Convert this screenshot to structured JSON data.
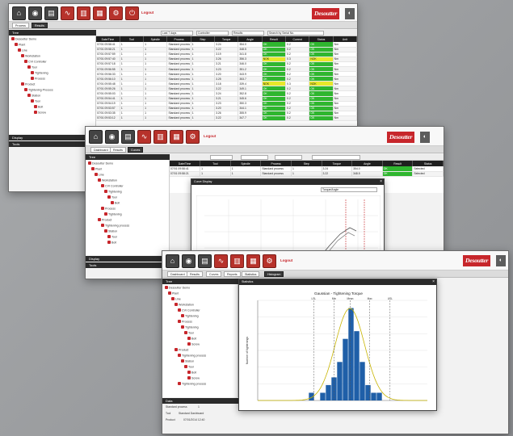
{
  "brand": {
    "name": "Desoutter",
    "mark": "◐"
  },
  "logout_label": "Logout",
  "window1": {
    "tabs": [
      "Process",
      "Results"
    ],
    "tree_header": "Tree",
    "tree": [
      "Desoutter Demo",
      "Plant",
      "Line",
      "Workstation",
      "CVI Controller",
      "Tool",
      "Tightening",
      "Process",
      "Product",
      "Tightening Process",
      "Station",
      "Tool",
      "Bolt",
      "Screw"
    ],
    "bottom_bars": [
      "Display",
      "Tools"
    ],
    "filter": {
      "date": "Last 7 days",
      "view": "Controller",
      "mode": "Results",
      "search": "Search by Serial No."
    },
    "columns": [
      "Date/Time",
      "Tool",
      "Spindle",
      "Process",
      "Step",
      "Torque",
      "Angle",
      "Result",
      "Current",
      "Status",
      "Unit"
    ],
    "rows": [
      [
        "07/01 09:58:41",
        "1",
        "1",
        "Standard process",
        "1",
        "3.24",
        "354.0",
        "OK",
        "0.2",
        "OK",
        "Nm"
      ],
      [
        "07/01 09:58:21",
        "1",
        "1",
        "Standard process",
        "1",
        "3.22",
        "348.5",
        "OK",
        "0.2",
        "OK",
        "Nm"
      ],
      [
        "07/01 09:57:59",
        "1",
        "1",
        "Standard process",
        "1",
        "3.19",
        "341.8",
        "OK",
        "0.2",
        "OK",
        "Nm"
      ],
      [
        "07/01 09:57:40",
        "1",
        "1",
        "Standard process",
        "1",
        "3.26",
        "356.3",
        "NOK",
        "0.3",
        "NOK",
        "Nm"
      ],
      [
        "07/01 09:57:18",
        "1",
        "1",
        "Standard process",
        "1",
        "3.21",
        "346.0",
        "OK",
        "0.2",
        "OK",
        "Nm"
      ],
      [
        "07/01 09:56:55",
        "1",
        "1",
        "Standard process",
        "1",
        "3.23",
        "351.2",
        "OK",
        "0.2",
        "OK",
        "Nm"
      ],
      [
        "07/01 09:56:33",
        "1",
        "1",
        "Standard process",
        "1",
        "3.20",
        "343.9",
        "OK",
        "0.2",
        "OK",
        "Nm"
      ],
      [
        "07/01 09:56:10",
        "1",
        "1",
        "Standard process",
        "1",
        "3.25",
        "353.7",
        "OK",
        "0.2",
        "OK",
        "Nm"
      ],
      [
        "07/01 09:55:48",
        "1",
        "1",
        "Standard process",
        "1",
        "3.18",
        "339.4",
        "NOK",
        "0.3",
        "NOK",
        "Nm"
      ],
      [
        "07/01 09:55:26",
        "1",
        "1",
        "Standard process",
        "1",
        "3.22",
        "349.1",
        "OK",
        "0.2",
        "OK",
        "Nm"
      ],
      [
        "07/01 09:55:03",
        "1",
        "1",
        "Standard process",
        "1",
        "3.24",
        "352.8",
        "OK",
        "0.2",
        "OK",
        "Nm"
      ],
      [
        "07/01 09:54:41",
        "1",
        "1",
        "Standard process",
        "1",
        "3.21",
        "345.6",
        "OK",
        "0.2",
        "OK",
        "Nm"
      ],
      [
        "07/01 09:54:19",
        "1",
        "1",
        "Standard process",
        "1",
        "3.23",
        "350.3",
        "OK",
        "0.2",
        "OK",
        "Nm"
      ],
      [
        "07/01 09:53:57",
        "1",
        "1",
        "Standard process",
        "1",
        "3.20",
        "344.1",
        "OK",
        "0.2",
        "OK",
        "Nm"
      ],
      [
        "07/01 09:53:35",
        "1",
        "1",
        "Standard process",
        "1",
        "3.26",
        "355.9",
        "OK",
        "0.2",
        "OK",
        "Nm"
      ],
      [
        "07/01 09:53:12",
        "1",
        "1",
        "Standard process",
        "1",
        "3.22",
        "347.7",
        "OK",
        "0.2",
        "OK",
        "Nm"
      ]
    ]
  },
  "window2": {
    "tabs": [
      "Dashboard",
      "Results",
      "Curves"
    ],
    "tree_header": "Tree",
    "tree": [
      "Desoutter Demo",
      "Plant",
      "Line",
      "Workstation",
      "CVI Controller",
      "Tightening",
      "Tool",
      "Bolt",
      "Process",
      "Tightening",
      "Product",
      "Tightening process",
      "Station",
      "Tool",
      "Bolt"
    ],
    "bottom_bars": [
      "Display",
      "Tools"
    ],
    "dialog_title": "Curve Display",
    "dialog_select": "Torque/Angle",
    "curve_columns": [
      "Date/Time",
      "Tool",
      "Spindle",
      "Process",
      "Step",
      "Torque",
      "Angle",
      "Result",
      "Status"
    ],
    "curve_rows": [
      [
        "07/01 09:58:41",
        "1",
        "1",
        "Standard process",
        "1",
        "3.24",
        "354.0",
        "OK",
        "Selected"
      ],
      [
        "07/01 09:58:21",
        "1",
        "1",
        "Standard process",
        "1",
        "3.22",
        "348.5",
        "OK",
        "Selected"
      ]
    ]
  },
  "window3": {
    "tabs": [
      "Dashboard",
      "Results",
      "Curves",
      "Reports",
      "Statistics",
      "Histogram"
    ],
    "tree_header": "Tree",
    "tree": [
      "Desoutter Demo",
      "Plant",
      "Line",
      "Workstation",
      "CVI Controller",
      "Tightening",
      "Process",
      "Tightening",
      "Tool",
      "Bolt",
      "Screw",
      "Product",
      "Tightening process",
      "Station",
      "Tool",
      "Bolt",
      "Screw",
      "Tightening process"
    ],
    "side_table_header": "Data",
    "side_table": [
      [
        "Standard process",
        "1"
      ],
      [
        "Tool",
        "Standard Dashboard"
      ],
      [
        "Product",
        "07/01/2014 12:40"
      ]
    ],
    "dialog_title": "Statistics",
    "histogram": {
      "title": "Gaussian - Tightening Torque",
      "ylabel": "Number of tightenings",
      "limits": [
        "LSL",
        "Min",
        "Mean",
        "Max",
        "USL"
      ]
    }
  },
  "chart_data": {
    "type": "bar",
    "title": "Gaussian - Tightening Torque",
    "ylabel": "Number of tightenings",
    "xlabel": "",
    "categories": [
      "b1",
      "b2",
      "b3",
      "b4",
      "b5",
      "b6",
      "b7",
      "b8",
      "b9",
      "b10",
      "b11",
      "b12",
      "b13",
      "b14",
      "b15",
      "b16",
      "b17",
      "b18",
      "b19",
      "b20",
      "b21",
      "b22",
      "b23",
      "b24",
      "b25",
      "b26",
      "b27",
      "b28",
      "b29",
      "b30"
    ],
    "values": [
      0,
      0,
      0,
      0,
      0,
      0,
      0,
      0,
      0,
      1,
      0,
      1,
      2,
      3,
      5,
      8,
      12,
      9,
      5,
      2,
      1,
      1,
      0,
      0,
      0,
      0,
      0,
      0,
      0,
      0
    ],
    "ylim": [
      0,
      13
    ],
    "colors": {
      "bars": "#1f5fa8",
      "curve": "#c8b400"
    }
  },
  "colors": {
    "brand": "#c7262b",
    "ok": "#2fb62f",
    "warn": "#e8e82a",
    "dark": "#2b2b2b"
  },
  "icons": [
    "home-icon",
    "dashboard-icon",
    "results-icon",
    "curves-icon",
    "reports-icon",
    "statistics-icon",
    "settings-icon",
    "logout-icon"
  ]
}
